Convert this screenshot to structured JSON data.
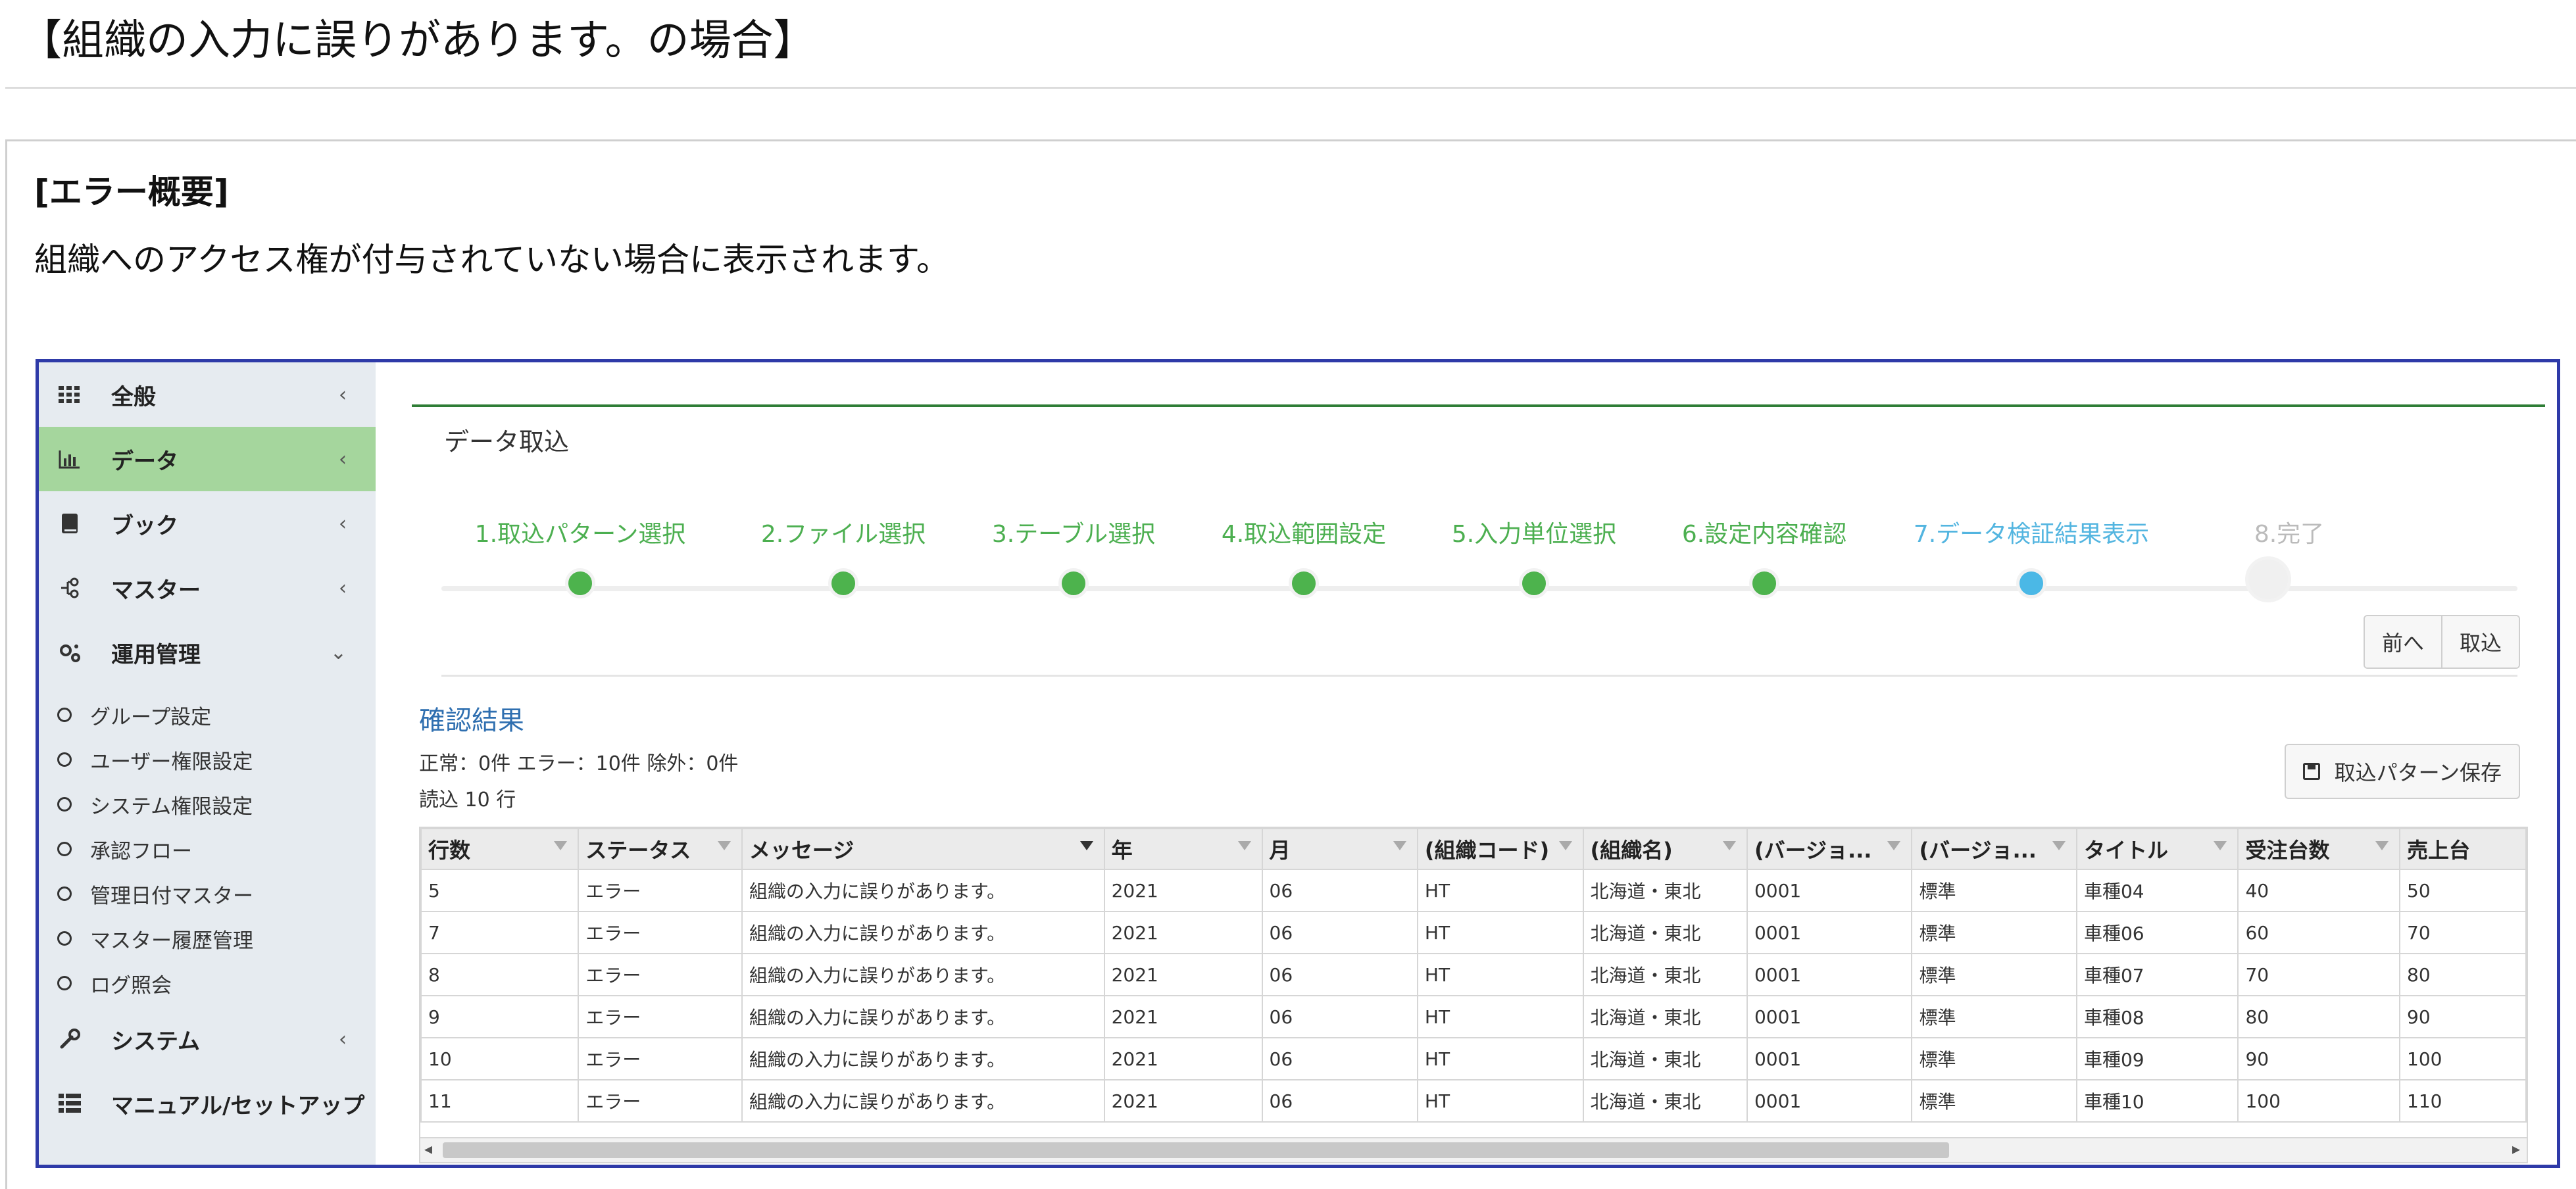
{
  "doc": {
    "page_title": "【組織の入力に誤りがあります。の場合】",
    "section_heading": "[エラー概要]",
    "section_desc": "組織へのアクセス権が付与されていない場合に表示されます。"
  },
  "sidebar": {
    "items": [
      {
        "label": "全般",
        "icon": "grid-icon",
        "chev": "‹"
      },
      {
        "label": "データ",
        "icon": "bar-chart-icon",
        "chev": "‹",
        "active": true
      },
      {
        "label": "ブック",
        "icon": "book-icon",
        "chev": "‹"
      },
      {
        "label": "マスター",
        "icon": "hierarchy-icon",
        "chev": "‹"
      },
      {
        "label": "運用管理",
        "icon": "gears-icon",
        "chev": "⌄"
      }
    ],
    "sub_items": [
      "グループ設定",
      "ユーザー権限設定",
      "システム権限設定",
      "承認フロー",
      "管理日付マスター",
      "マスター履歴管理",
      "ログ照会"
    ],
    "bottom_items": [
      {
        "label": "システム",
        "icon": "wrench-icon",
        "chev": "‹"
      },
      {
        "label": "マニュアル/セットアップ",
        "icon": "list-icon"
      }
    ]
  },
  "main": {
    "panel_title": "データ取込",
    "steps": [
      {
        "label": "1.取込パターン選択",
        "state": "done"
      },
      {
        "label": "2.ファイル選択",
        "state": "done"
      },
      {
        "label": "3.テーブル選択",
        "state": "done"
      },
      {
        "label": "4.取込範囲設定",
        "state": "done"
      },
      {
        "label": "5.入力単位選択",
        "state": "done"
      },
      {
        "label": "6.設定内容確認",
        "state": "done"
      },
      {
        "label": "7.データ検証結果表示",
        "state": "current"
      },
      {
        "label": "8.完了",
        "state": "pending"
      }
    ],
    "prev_label": "前へ",
    "import_label": "取込",
    "result_title": "確認結果",
    "counts": "正常：0件 エラー：10件 除外：0件",
    "rows_read": "読込 10 行",
    "save_pattern_label": "取込パターン保存",
    "table": {
      "columns": [
        "行数",
        "ステータス",
        "メッセージ",
        "年",
        "月",
        "(組織コード)",
        "(組織名)",
        "(バージョ...",
        "(バージョ...",
        "タイトル",
        "受注台数",
        "売上台"
      ],
      "rows": [
        [
          "5",
          "エラー",
          "組織の入力に誤りがあります。",
          "2021",
          "06",
          "HT",
          "北海道・東北",
          "0001",
          "標準",
          "車種04",
          "40",
          "50"
        ],
        [
          "7",
          "エラー",
          "組織の入力に誤りがあります。",
          "2021",
          "06",
          "HT",
          "北海道・東北",
          "0001",
          "標準",
          "車種06",
          "60",
          "70"
        ],
        [
          "8",
          "エラー",
          "組織の入力に誤りがあります。",
          "2021",
          "06",
          "HT",
          "北海道・東北",
          "0001",
          "標準",
          "車種07",
          "70",
          "80"
        ],
        [
          "9",
          "エラー",
          "組織の入力に誤りがあります。",
          "2021",
          "06",
          "HT",
          "北海道・東北",
          "0001",
          "標準",
          "車種08",
          "80",
          "90"
        ],
        [
          "10",
          "エラー",
          "組織の入力に誤りがあります。",
          "2021",
          "06",
          "HT",
          "北海道・東北",
          "0001",
          "標準",
          "車種09",
          "90",
          "100"
        ],
        [
          "11",
          "エラー",
          "組織の入力に誤りがあります。",
          "2021",
          "06",
          "HT",
          "北海道・東北",
          "0001",
          "標準",
          "車種10",
          "100",
          "110"
        ]
      ]
    }
  }
}
